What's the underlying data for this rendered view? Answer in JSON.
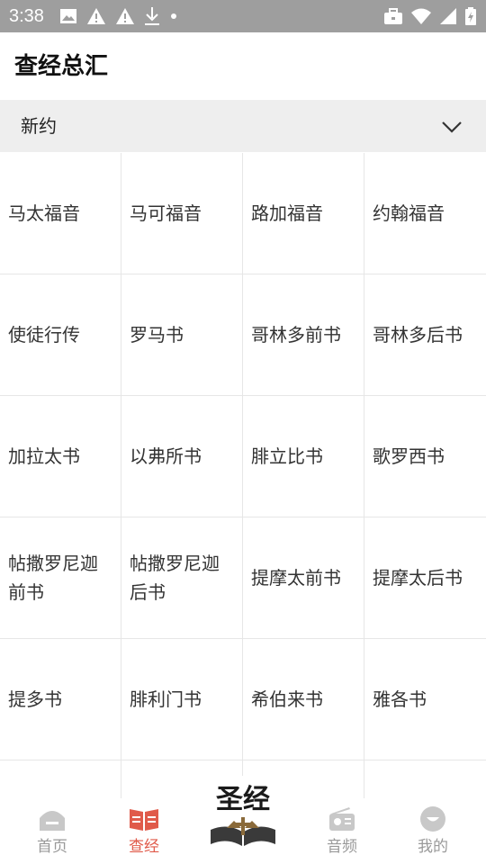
{
  "status_bar": {
    "time": "3:38",
    "left_icons": [
      "image-icon",
      "warning-icon",
      "warning-icon",
      "download-icon",
      "dot-icon"
    ],
    "right_icons": [
      "briefcase-icon",
      "wifi-icon",
      "signal-icon",
      "battery-icon"
    ]
  },
  "header": {
    "title": "查经总汇"
  },
  "testament": {
    "selected": "新约"
  },
  "books": [
    "马太福音",
    "马可福音",
    "路加福音",
    "约翰福音",
    "使徒行传",
    "罗马书",
    "哥林多前书",
    "哥林多后书",
    "加拉太书",
    "以弗所书",
    "腓立比书",
    "歌罗西书",
    "帖撒罗尼迦前书",
    "帖撒罗尼迦后书",
    "提摩太前书",
    "提摩太后书",
    "提多书",
    "腓利门书",
    "希伯来书",
    "雅各书",
    "",
    "",
    "",
    ""
  ],
  "bottom_nav": {
    "home": "首页",
    "study": "查经",
    "center_logo": "圣经",
    "audio": "音频",
    "mine": "我的"
  },
  "colors": {
    "accent": "#e05a4a",
    "inactive": "#999999",
    "status_bar": "#9e9e9e",
    "selector_bg": "#eeeeee"
  }
}
